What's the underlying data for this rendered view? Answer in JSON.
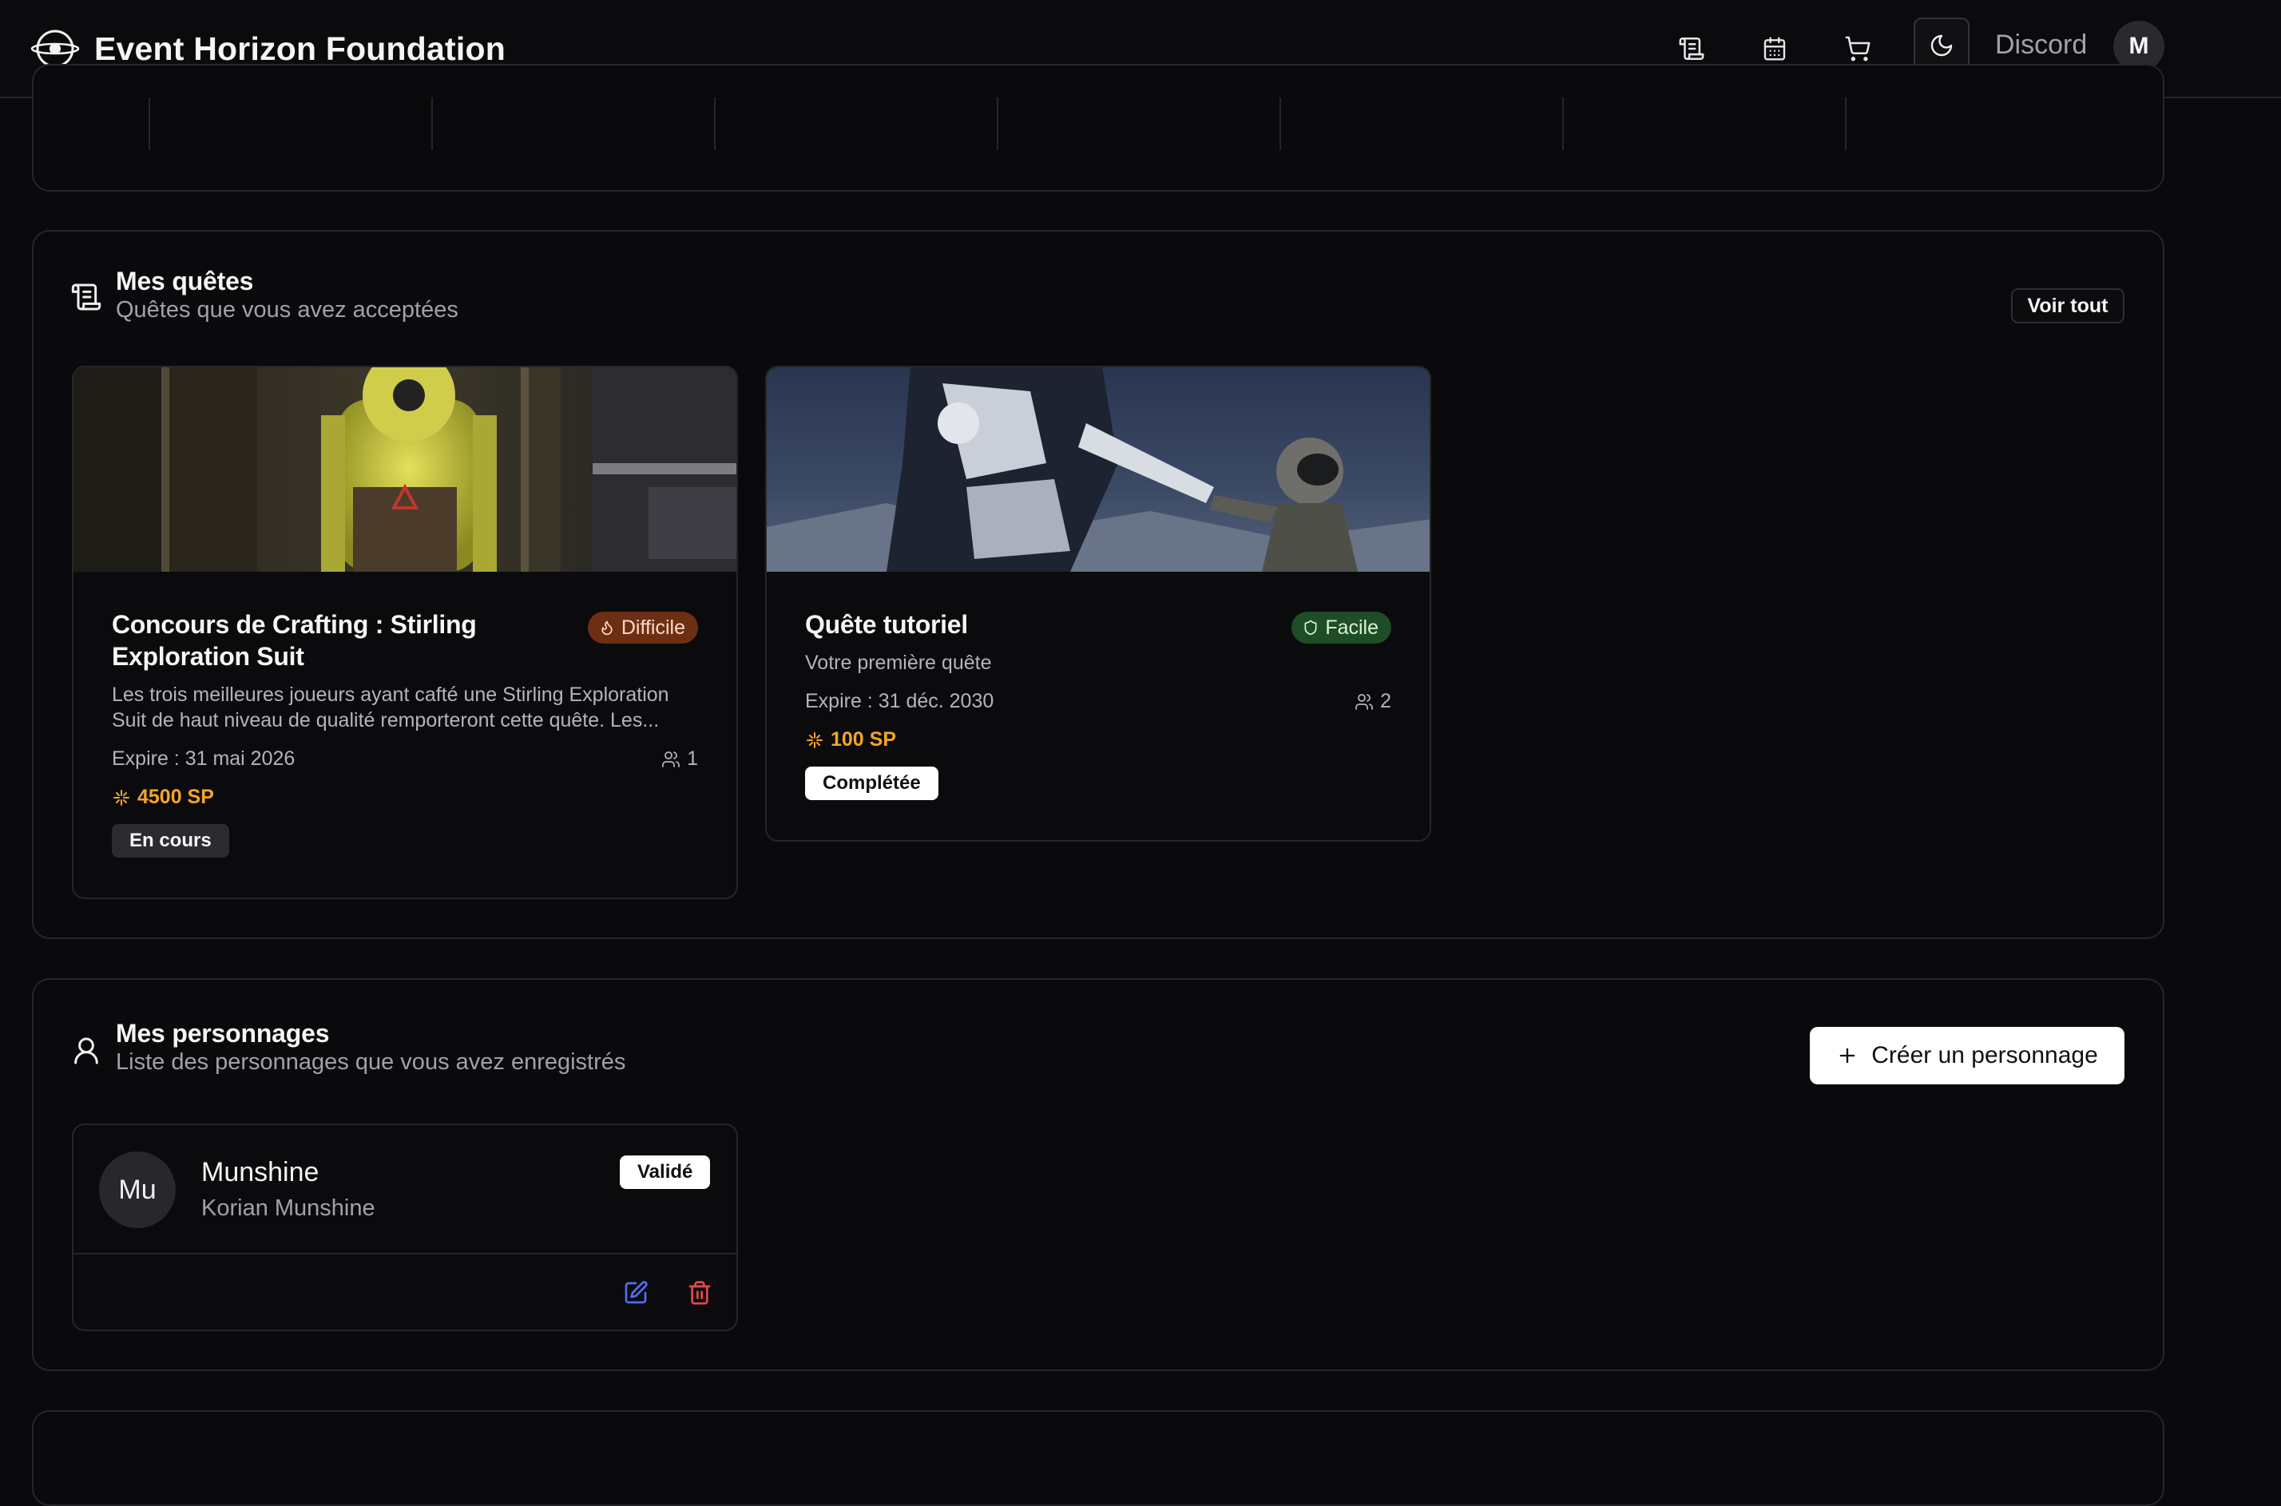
{
  "header": {
    "app_name": "Event Horizon Foundation",
    "icons": [
      "scroll-icon",
      "calendar-icon",
      "cart-icon",
      "moon-icon"
    ],
    "discord_label": "Discord",
    "user_initial": "M"
  },
  "quests_section": {
    "title": "Mes quêtes",
    "subtitle": "Quêtes que vous avez acceptées",
    "view_all_label": "Voir tout",
    "quests": [
      {
        "title": "Concours de Crafting : Stirling Exploration Suit",
        "difficulty": "Difficile",
        "description": "Les trois meilleures joueurs ayant cafté une Stirling Exploration Suit de haut niveau de qualité remporteront cette quête. Les...",
        "expires": "Expire : 31 mai 2026",
        "participants": "1",
        "reward": "4500 SP",
        "status": "En cours"
      },
      {
        "title": "Quête tutoriel",
        "difficulty": "Facile",
        "description": "Votre première quête",
        "expires": "Expire : 31 déc. 2030",
        "participants": "2",
        "reward": "100 SP",
        "status": "Complétée"
      }
    ]
  },
  "characters_section": {
    "title": "Mes personnages",
    "subtitle": "Liste des personnages que vous avez enregistrés",
    "create_label": "Créer un personnage",
    "characters": [
      {
        "initials": "Mu",
        "name": "Munshine",
        "full_name": "Korian Munshine",
        "status": "Validé"
      }
    ]
  },
  "colors": {
    "background": "#0a0a0c",
    "border": "#26262a",
    "reward": "#f5a524",
    "difficulty_hard_bg": "#6d2f14",
    "difficulty_easy_bg": "#1f4d25",
    "edit": "#4f6ef7",
    "delete": "#e5484d"
  }
}
